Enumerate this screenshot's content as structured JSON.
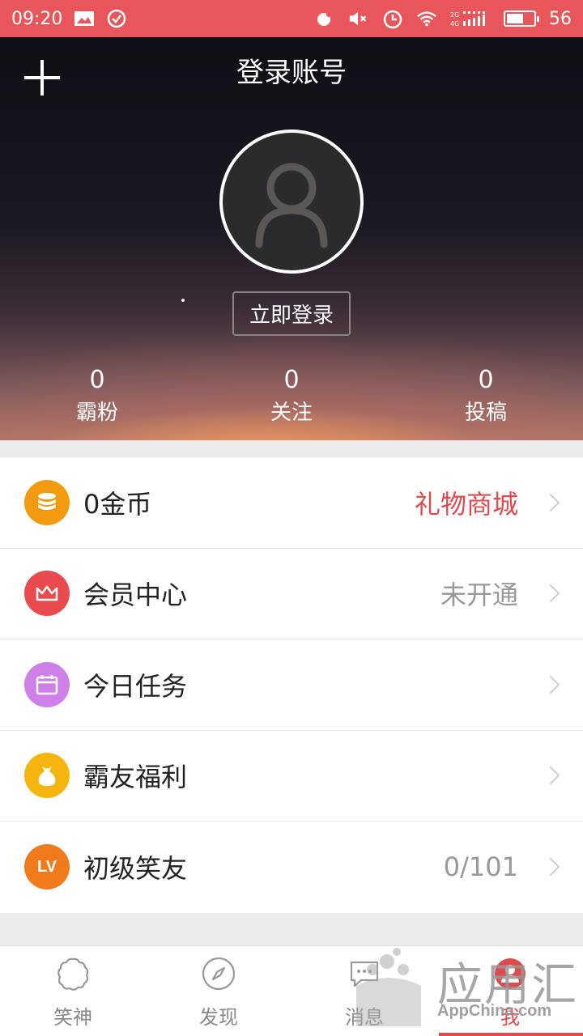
{
  "status_bar": {
    "time": "09:20",
    "battery_level": "56",
    "icons": [
      "image-icon",
      "check-circle-icon",
      "hand-icon",
      "mute-icon",
      "alarm-icon",
      "wifi-icon",
      "signal-icon",
      "battery-icon"
    ]
  },
  "header": {
    "title": "登录账号",
    "login_button": "立即登录",
    "stats": [
      {
        "value": "0",
        "label": "霸粉"
      },
      {
        "value": "0",
        "label": "关注"
      },
      {
        "value": "0",
        "label": "投稿"
      }
    ]
  },
  "menu": [
    {
      "label": "0金币",
      "value": "礼物商城",
      "icon": "coin-stack-icon",
      "color": "#f29b11"
    },
    {
      "label": "会员中心",
      "value": "未开通",
      "icon": "crown-icon",
      "color": "#e84a4e"
    },
    {
      "label": "今日任务",
      "value": "",
      "icon": "calendar-icon",
      "color": "#cf80e8"
    },
    {
      "label": "霸友福利",
      "value": "",
      "icon": "gift-bag-icon",
      "color": "#f5b50f"
    },
    {
      "label": "初级笑友",
      "value": "0/101",
      "icon": "level-badge-icon",
      "color": "#f07a1c",
      "badge": "LV"
    }
  ],
  "bottom_nav": [
    {
      "label": "笑神",
      "icon": "laugh-god-icon"
    },
    {
      "label": "发现",
      "icon": "compass-icon"
    },
    {
      "label": "消息",
      "icon": "chat-bubble-icon"
    },
    {
      "label": "我",
      "icon": "me-icon",
      "active": true
    }
  ],
  "watermark": {
    "text": "应用汇",
    "sub": "AppChina.com"
  },
  "colors": {
    "accent": "#e14a4d",
    "status_bar": "#e8555a"
  }
}
